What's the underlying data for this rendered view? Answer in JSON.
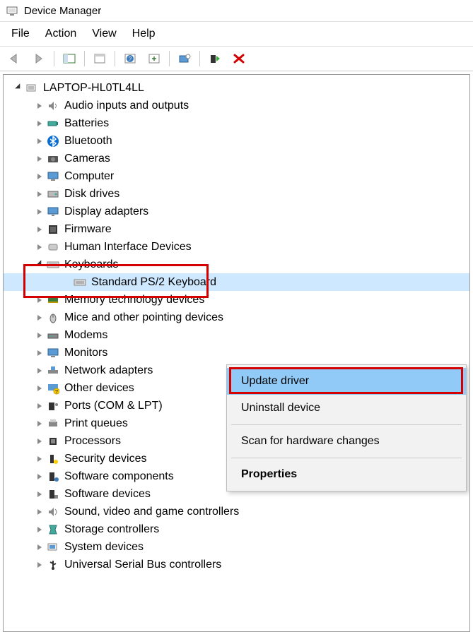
{
  "window": {
    "title": "Device Manager"
  },
  "menu": {
    "file": "File",
    "action": "Action",
    "view": "View",
    "help": "Help"
  },
  "root": {
    "label": "LAPTOP-HL0TL4LL"
  },
  "categories": [
    {
      "label": "Audio inputs and outputs",
      "icon": "speaker"
    },
    {
      "label": "Batteries",
      "icon": "battery"
    },
    {
      "label": "Bluetooth",
      "icon": "bluetooth"
    },
    {
      "label": "Cameras",
      "icon": "camera"
    },
    {
      "label": "Computer",
      "icon": "computer"
    },
    {
      "label": "Disk drives",
      "icon": "disk"
    },
    {
      "label": "Display adapters",
      "icon": "display"
    },
    {
      "label": "Firmware",
      "icon": "firmware"
    },
    {
      "label": "Human Interface Devices",
      "icon": "hid"
    },
    {
      "label": "Keyboards",
      "icon": "keyboard",
      "expanded": true,
      "children": [
        {
          "label": "Standard PS/2 Keyboard",
          "icon": "keyboard",
          "selected": true
        }
      ]
    },
    {
      "label": "Memory technology devices",
      "icon": "memory"
    },
    {
      "label": "Mice and other pointing devices",
      "icon": "mouse"
    },
    {
      "label": "Modems",
      "icon": "modem"
    },
    {
      "label": "Monitors",
      "icon": "monitor"
    },
    {
      "label": "Network adapters",
      "icon": "network"
    },
    {
      "label": "Other devices",
      "icon": "other"
    },
    {
      "label": "Ports (COM & LPT)",
      "icon": "port"
    },
    {
      "label": "Print queues",
      "icon": "printer"
    },
    {
      "label": "Processors",
      "icon": "cpu"
    },
    {
      "label": "Security devices",
      "icon": "security"
    },
    {
      "label": "Software components",
      "icon": "swcomp"
    },
    {
      "label": "Software devices",
      "icon": "swdev"
    },
    {
      "label": "Sound, video and game controllers",
      "icon": "sound"
    },
    {
      "label": "Storage controllers",
      "icon": "storage"
    },
    {
      "label": "System devices",
      "icon": "system"
    },
    {
      "label": "Universal Serial Bus controllers",
      "icon": "usb"
    }
  ],
  "context_menu": {
    "update": "Update driver",
    "uninstall": "Uninstall device",
    "scan": "Scan for hardware changes",
    "properties": "Properties"
  }
}
